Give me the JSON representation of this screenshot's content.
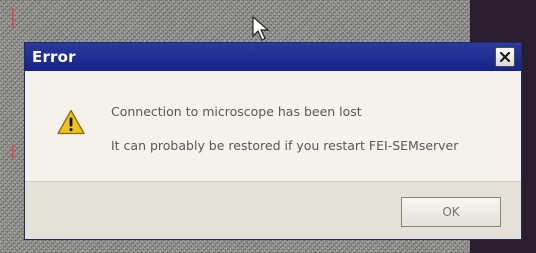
{
  "dialog": {
    "title": "Error",
    "close_icon": "close-icon",
    "warning_icon": "warning-triangle-icon",
    "messages": [
      "Connection to microscope has been lost",
      "It can probably be restored if you restart FEI-SEMserver"
    ],
    "ok_label": "OK"
  },
  "colors": {
    "title_bar": "#16238a",
    "dialog_background": "#ece9de",
    "warning_yellow": "#f3c21a",
    "text": "#56585e"
  }
}
